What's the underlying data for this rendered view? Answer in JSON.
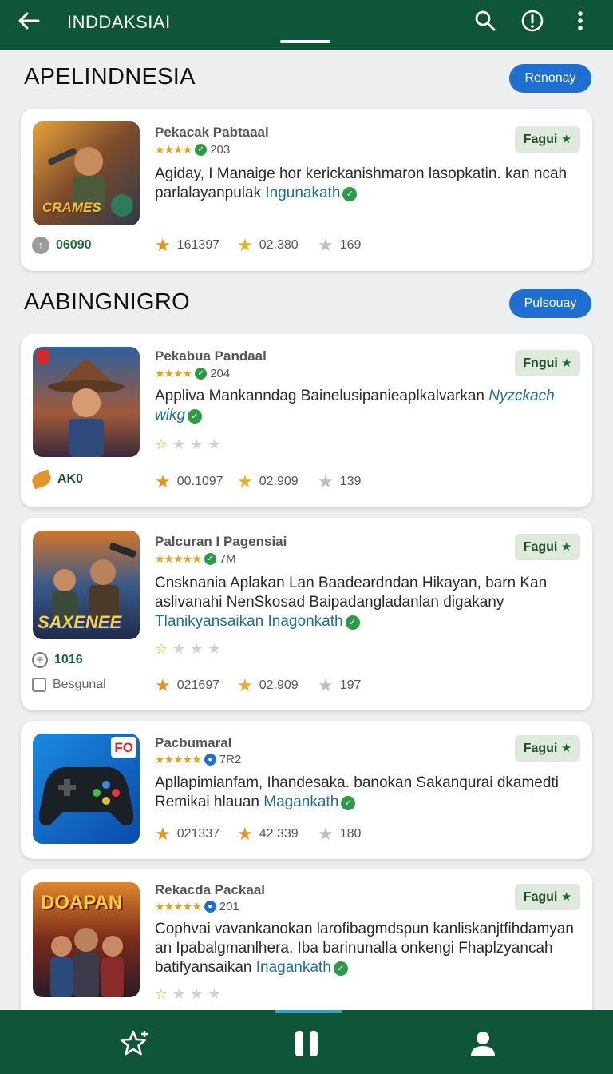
{
  "topbar": {
    "title": "INDDAKSIAI"
  },
  "sections": [
    {
      "title": "APELINDNESIA",
      "button": "Renonay"
    },
    {
      "title": "AABINGNIGRO",
      "button": "Pulsouay"
    }
  ],
  "cards": [
    {
      "name": "Pekacak Pabtaaal",
      "rating_count": "203",
      "description": "Agiday, I Manaige hor kerickanishmaron lasopkatin. kan ncah parlalayanpulak ",
      "link": "Ingunakath",
      "favorite_label": "Fagui",
      "left_meta": "06090",
      "stats": [
        "161397",
        "02.380",
        "169"
      ],
      "thumb_text": "CRAMES"
    },
    {
      "name": "Pekabua Pandaal",
      "rating_count": "204",
      "description": "Appliva Mankanndag Bainelusipanieaplkalvarkan ",
      "link": "Nyzckach wikg",
      "favorite_label": "Fngui",
      "left_meta": "AK0",
      "stats": [
        "00.1097",
        "02.909",
        "139"
      ],
      "thumb_text": ""
    },
    {
      "name": "Palcuran I Pagensiai",
      "rating_count": "7M",
      "description": "Cnsknania Aplakan Lan Baadeardndan Hikayan, barn Kan aslivanahi NenSkosad Baipadangladanlan digakany ",
      "link": "Tlanikyansaikan Inagonkath",
      "favorite_label": "Fagui",
      "left_meta": "1016",
      "left_meta_2": "Besgunal",
      "stats": [
        "021697",
        "02.909",
        "197"
      ],
      "thumb_text": "SAXENEE"
    },
    {
      "name": "Pacbumaral",
      "rating_count": "7R2",
      "description": "Apllapimianfam, Ihandesaka. banokan Sakanqurai dkamedti Remikai hlauan ",
      "link": "Magankath",
      "favorite_label": "Fagui",
      "stats": [
        "021337",
        "42.339",
        "180"
      ],
      "thumb_text": "FO"
    },
    {
      "name": "Rekacda Packaal",
      "rating_count": "201",
      "description": "Cophvai vavankanokan larofibagmdspun kanliskanjtfihdamyan an Ipabalgmanlhera, Iba barinunalla onkengi Fhaplzyancah batifyansaikan ",
      "link": "Inagankath",
      "favorite_label": "Fagui",
      "thumb_text": "DOAPAN"
    }
  ],
  "colors": {
    "header": "#0f5537",
    "accent": "#1e6fd0",
    "star": "#e6a21c",
    "link": "#1f6f8d"
  },
  "icons": [
    "back-arrow-icon",
    "search-icon",
    "info-icon",
    "more-vert-icon",
    "star-outline-icon",
    "pause-icon",
    "person-icon"
  ]
}
